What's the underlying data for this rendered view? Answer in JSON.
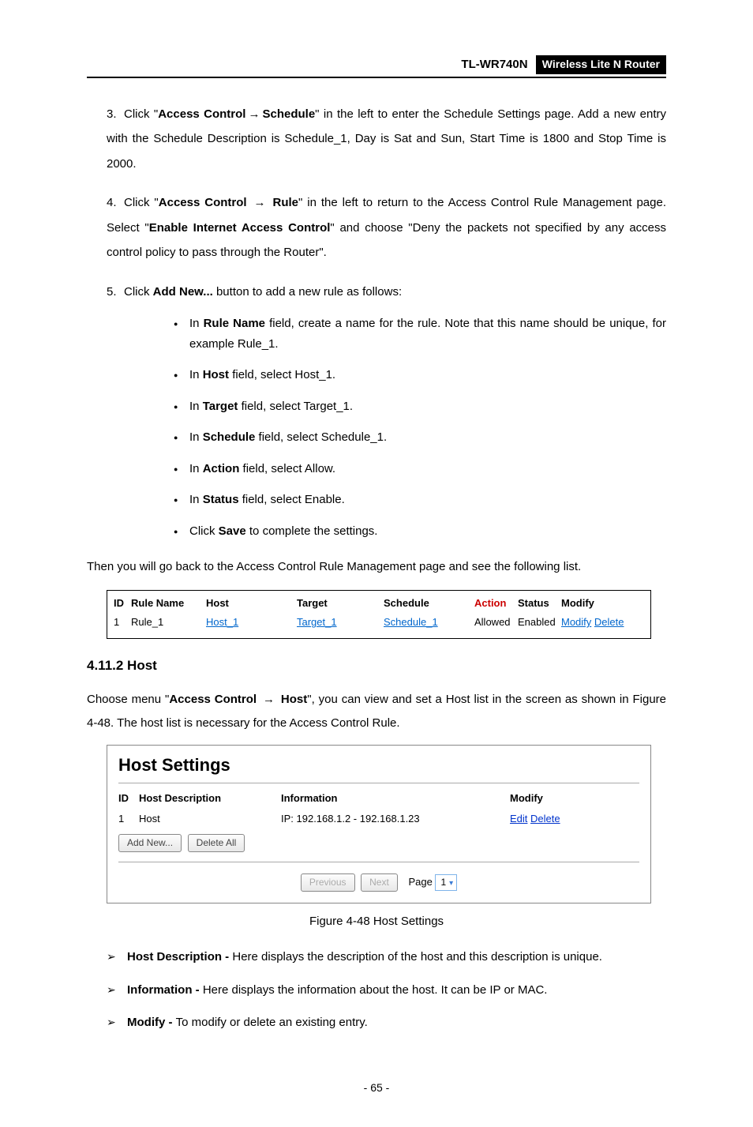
{
  "header": {
    "model": "TL-WR740N",
    "badge": "Wireless Lite N Router"
  },
  "steps": {
    "s3": {
      "num": "3.",
      "pre": "Click \"",
      "ac": "Access Control",
      "arrow": "→",
      "sched_b": "Schedule",
      "post": "\" in the left to enter the Schedule Settings page. Add a new entry with the Schedule Description is Schedule_1, Day is Sat and Sun, Start Time is 1800 and Stop Time is 2000."
    },
    "s4": {
      "num": "4.",
      "pre": "Click \"",
      "ac": "Access Control",
      "arrow": "→",
      "rule_b": "Rule",
      "mid": "\" in the left to return to the Access Control Rule Management page. Select \"",
      "enable": "Enable Internet Access Control",
      "post": "\" and choose \"Deny the packets not specified by any access control policy to pass through the Router\"."
    },
    "s5": {
      "num": "5.",
      "pre": "Click ",
      "addnew": "Add New...",
      "post": " button to add a new rule as follows:",
      "bullets": {
        "b1": {
          "p1": "In ",
          "b": "Rule Name",
          "p2": " field, create a name for the rule. Note that this name should be unique, for example Rule_1."
        },
        "b2": {
          "p1": "In ",
          "b": "Host",
          "p2": " field, select Host_1."
        },
        "b3": {
          "p1": "In ",
          "b": "Target",
          "p2": " field, select Target_1."
        },
        "b4": {
          "p1": "In ",
          "b": "Schedule",
          "p2": " field, select Schedule_1."
        },
        "b5": {
          "p1": "In ",
          "b": "Action",
          "p2": " field, select Allow."
        },
        "b6": {
          "p1": "In ",
          "b": "Status",
          "p2": " field, select Enable."
        },
        "b7": {
          "p1": "Click ",
          "b": "Save",
          "p2": " to complete the settings."
        }
      }
    }
  },
  "then_text": "Then you will go back to the Access Control Rule Management page and see the following list.",
  "rule_table": {
    "head": {
      "id": "ID",
      "rule": "Rule Name",
      "host": "Host",
      "target": "Target",
      "sched": "Schedule",
      "action": "Action",
      "status": "Status",
      "modify": "Modify"
    },
    "row": {
      "id": "1",
      "rule": "Rule_1",
      "host": "Host_1",
      "target": "Target_1",
      "sched": "Schedule_1",
      "action": "Allowed",
      "status": "Enabled",
      "mod": "Modify",
      "del": "Delete"
    }
  },
  "section_host": {
    "title": "4.11.2   Host",
    "para_pre": "Choose menu \"",
    "ac": "Access Control",
    "arrow": "→",
    "host_b": "Host",
    "para_post": "\", you can view and set a Host list in the screen as shown in Figure 4-48. The host list is necessary for the Access Control Rule."
  },
  "host_panel": {
    "title": "Host Settings",
    "head": {
      "id": "ID",
      "desc": "Host Description",
      "info": "Information",
      "mod": "Modify"
    },
    "row": {
      "id": "1",
      "desc": "Host",
      "info": "IP: 192.168.1.2 - 192.168.1.23",
      "edit": "Edit",
      "del": "Delete"
    },
    "btn_add": "Add New...",
    "btn_delall": "Delete All",
    "btn_prev": "Previous",
    "btn_next": "Next",
    "page_label": "Page",
    "page_val": "1"
  },
  "figure_caption": "Figure 4-48    Host Settings",
  "glossary": {
    "g1": {
      "b": "Host Description - ",
      "t": "Here displays the description of the host and this description is unique."
    },
    "g2": {
      "b": "Information - ",
      "t": "Here displays the information about the host. It can be IP or MAC."
    },
    "g3": {
      "b": "Modify - ",
      "t": "To modify or delete an existing entry."
    }
  },
  "page_num": "- 65 -"
}
